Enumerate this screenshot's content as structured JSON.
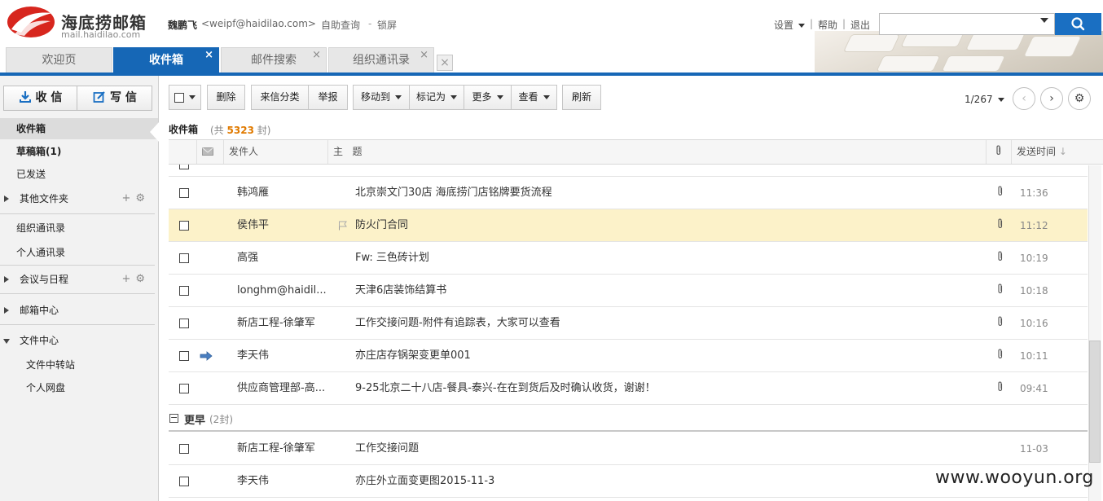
{
  "header": {
    "brand_name": "海底捞邮箱",
    "brand_domain": "mail.haidilao.com",
    "user_name": "魏鹏飞",
    "user_email": "<weipf@haidilao.com>",
    "self_query": "自助查询",
    "separator": "-",
    "lock_screen": "锁屏",
    "settings": "设置",
    "help": "帮助",
    "logout": "退出",
    "search_placeholder": ""
  },
  "tabs": [
    {
      "label": "欢迎页"
    },
    {
      "label": "收件箱"
    },
    {
      "label": "邮件搜索"
    },
    {
      "label": "组织通讯录"
    }
  ],
  "sidebar": {
    "receive": "收 信",
    "write": "写 信",
    "items": [
      {
        "label": "收件箱"
      },
      {
        "label": "草稿箱(1)"
      },
      {
        "label": "已发送"
      },
      {
        "label": "其他文件夹"
      },
      {
        "label": "组织通讯录"
      },
      {
        "label": "个人通讯录"
      },
      {
        "label": "会议与日程"
      },
      {
        "label": "邮箱中心"
      },
      {
        "label": "文件中心"
      },
      {
        "label": "文件中转站"
      },
      {
        "label": "个人网盘"
      }
    ]
  },
  "toolbar": {
    "delete": "删除",
    "classify": "来信分类",
    "report": "举报",
    "move_to": "移动到",
    "mark_as": "标记为",
    "more": "更多",
    "view": "查看",
    "refresh": "刷新",
    "pager": "1/267"
  },
  "folder": {
    "title": "收件箱",
    "total_prefix": "(共",
    "total_count": "5323",
    "total_suffix": "封)"
  },
  "list_header": {
    "sender": "发件人",
    "subject_a": "主",
    "subject_b": "题",
    "time": "发送时间"
  },
  "emails": [
    {
      "sender": "韩鸿雁",
      "subject": "北京崇文门30店 海底捞门店铭牌要货流程",
      "time": "11:36",
      "attachment": true
    },
    {
      "sender": "侯伟平",
      "subject": "防火门合同",
      "time": "11:12",
      "attachment": true,
      "flag": true,
      "highlighted": true
    },
    {
      "sender": "高强",
      "subject": "Fw: 三色砖计划",
      "time": "10:19",
      "attachment": true
    },
    {
      "sender": "longhm@haidil...",
      "subject": "天津6店装饰结算书",
      "time": "10:18",
      "attachment": true
    },
    {
      "sender": "新店工程-徐肇军",
      "subject": "工作交接问题-附件有追踪表，大家可以查看",
      "time": "10:16",
      "attachment": true
    },
    {
      "sender": "李天伟",
      "subject": "亦庄店存锅架变更单001",
      "time": "10:11",
      "attachment": true,
      "replied": true
    },
    {
      "sender": "供应商管理部-高...",
      "subject": "9-25北京二十八店-餐具-泰兴-在在到货后及时确认收货，谢谢！",
      "time": "09:41",
      "attachment": true
    }
  ],
  "earlier_group": {
    "label": "更早",
    "count": "(2封)"
  },
  "earlier_emails": [
    {
      "sender": "新店工程-徐肇军",
      "subject": "工作交接问题",
      "time": "11-03"
    },
    {
      "sender": "李天伟",
      "subject": "亦庄外立面变更图2015-11-3",
      "time": ""
    }
  ],
  "watermark": "www.wooyun.org",
  "colors": {
    "accent": "#1667b6",
    "highlight_row": "#fcf2c9",
    "count_orange": "#e07a00"
  }
}
